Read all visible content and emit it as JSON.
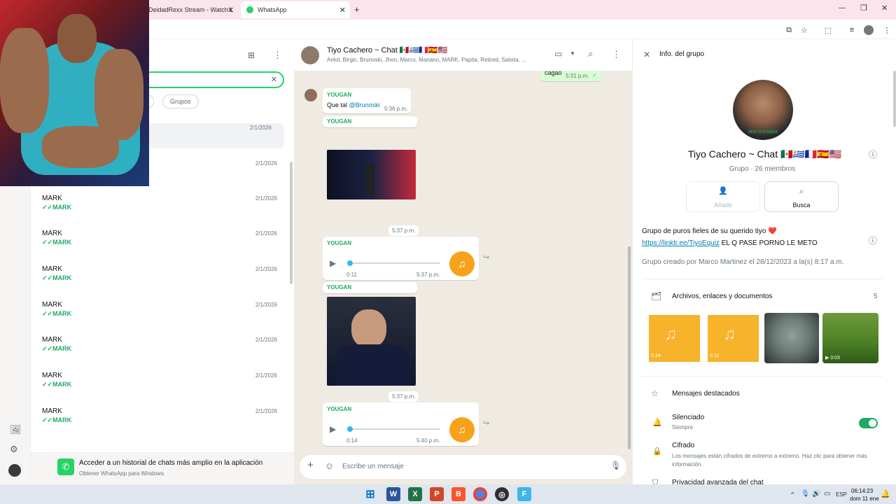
{
  "browser": {
    "tabs": [
      {
        "label": "DeidadRexx Stream - Watch L"
      },
      {
        "label": "WhatsApp"
      }
    ],
    "new_tab": "+"
  },
  "chat_list": {
    "search_clear": "✕",
    "filters": [
      "s",
      "Grupos"
    ],
    "rows": [
      {
        "name": "",
        "sub": "",
        "date": "2/1/2026"
      },
      {
        "name": "",
        "sub": "",
        "date": "2/1/2026"
      },
      {
        "name": "MARK",
        "sub": "MARK",
        "date": "2/1/2026"
      },
      {
        "name": "MARK",
        "sub": "MARK",
        "date": "2/1/2026"
      },
      {
        "name": "MARK",
        "sub": "MARK",
        "date": "2/1/2026"
      },
      {
        "name": "MARK",
        "sub": "MARK",
        "date": "2/1/2026"
      },
      {
        "name": "MARK",
        "sub": "MARK",
        "date": "2/1/2026"
      },
      {
        "name": "MARK",
        "sub": "MARK",
        "date": "2/1/2026"
      },
      {
        "name": "MARK",
        "sub": "MARK",
        "date": "2/1/2026"
      }
    ],
    "promo": {
      "title": "Acceder a un historial de chats más amplio en la aplicación",
      "subtitle": "Obtener WhatsApp para Windows"
    }
  },
  "chat": {
    "title": "Tiyo Cachero ~ Chat 🇲🇽🇺🇾🇫🇷🇪🇸🇺🇸",
    "members": "Antol, Birgic, Brunoski, Jhon, Marco, Mariano, MARK, Papita, Retired, Salsita, ...",
    "top_bubble": {
      "text": "cagao",
      "time": "5:31 p.m."
    },
    "msg1": {
      "sender": "YOUGAN",
      "text": "Que tal ",
      "mention": "@Brunoski",
      "time": "5:36 p.m."
    },
    "msg2": {
      "sender": "YOUGAN"
    },
    "date_chip1": "5:37 p.m.",
    "audio1": {
      "sender": "YOUGAN",
      "duration": "0:11",
      "time": "5:37 p.m."
    },
    "msg3": {
      "sender": "YOUGAN"
    },
    "date_chip2": "5:37 p.m.",
    "audio2": {
      "sender": "YOUGAN",
      "duration": "0:14",
      "time": "5:40 p.m."
    },
    "compose_placeholder": "Escribe un mensaje"
  },
  "info": {
    "header": "Info. del grupo",
    "avatar_caption": "NICK TIYO EQUIZ",
    "name": "Tiyo Cachero ~ Chat 🇲🇽🇺🇾🇫🇷🇪🇸🇺🇸",
    "meta": "Grupo · 26 miembros",
    "add_label": "Añadir",
    "search_label": "Busca",
    "description": "Grupo de puros fieles de su querido tiyo ❤️",
    "link": "https://linktr.ee/TiyoEquiz",
    "link_rest": " EL Q PASE PORNO LE METO",
    "created": "Grupo creado por Marco Martinez el 28/12/2023 a la(s) 8:17 a.m.",
    "files_label": "Archivos, enlaces y documentos",
    "files_count": "5",
    "media": [
      {
        "type": "audio",
        "dur": "0:14"
      },
      {
        "type": "audio",
        "dur": "0:11"
      },
      {
        "type": "image",
        "dur": ""
      },
      {
        "type": "video",
        "dur": "0:03"
      }
    ],
    "starred": "Mensajes destacados",
    "muted": "Silenciado",
    "muted_sub": "Siempre",
    "muted_on": true,
    "encrypt": "Cifrado",
    "encrypt_sub": "Los mensajes están cifrados de extremo a extremo. Haz clic para obtener más información.",
    "privacy": "Privacidad avanzada del chat"
  },
  "taskbar": {
    "lang": "ESP",
    "time": "06:14:23",
    "date": "dom 11 ene"
  },
  "colors": {
    "accent": "#1daa61",
    "audio": "#f7a21b",
    "chat_bg": "#efeae2",
    "tab_bar": "#fbe4ec"
  }
}
